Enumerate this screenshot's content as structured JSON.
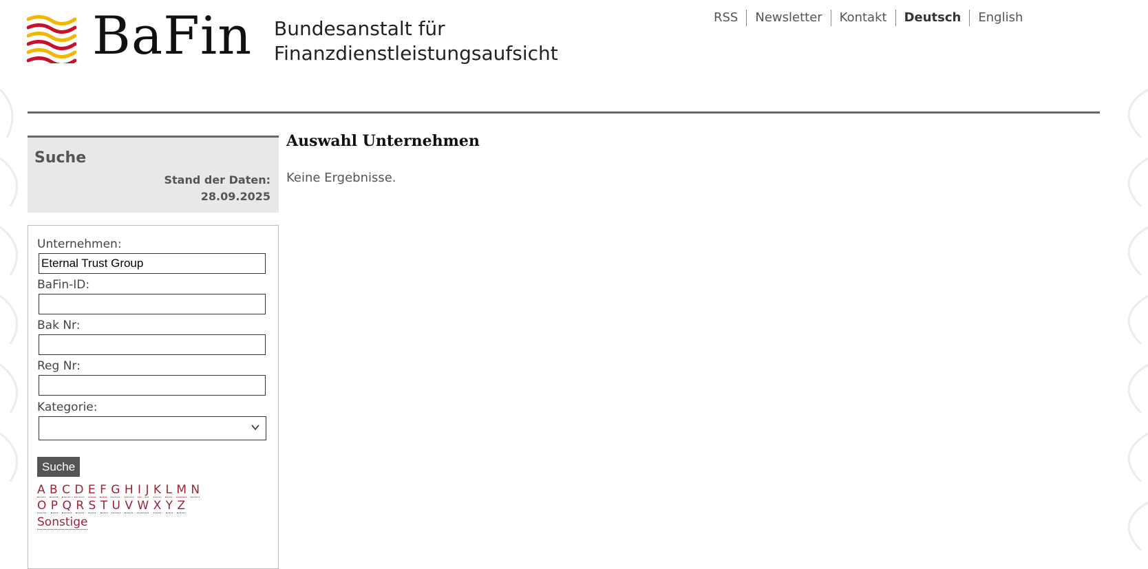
{
  "header": {
    "logo_word": "BaFin",
    "logo_sub_line1": "Bundesanstalt für",
    "logo_sub_line2": "Finanzdienstleistungsaufsicht",
    "nav": [
      {
        "label": "RSS"
      },
      {
        "label": "Newsletter"
      },
      {
        "label": "Kontakt"
      },
      {
        "label": "Deutsch",
        "active": true
      },
      {
        "label": "English"
      }
    ]
  },
  "sidebar": {
    "title": "Suche",
    "stand_label": "Stand der Daten:",
    "stand_date": "28.09.2025",
    "fields": {
      "unternehmen_label": "Unternehmen:",
      "unternehmen_value": "Eternal Trust Group",
      "bafin_id_label": "BaFin-ID:",
      "bafin_id_value": "",
      "bak_nr_label": "Bak Nr:",
      "bak_nr_value": "",
      "reg_nr_label": "Reg Nr:",
      "reg_nr_value": "",
      "kategorie_label": "Kategorie:",
      "kategorie_value": ""
    },
    "search_button": "Suche",
    "alpha_row1": [
      "A",
      "B",
      "C",
      "D",
      "E",
      "F",
      "G",
      "H",
      "I",
      "J",
      "K",
      "L",
      "M",
      "N"
    ],
    "alpha_row2": [
      "O",
      "P",
      "Q",
      "R",
      "S",
      "T",
      "U",
      "V",
      "W",
      "X",
      "Y",
      "Z"
    ],
    "other_link": "Sonstige"
  },
  "main": {
    "title": "Auswahl Unternehmen",
    "message": "Keine Ergebnisse."
  },
  "colors": {
    "link": "#9b2335",
    "rule": "#666666",
    "panel_bg": "#e8e8e8",
    "logo_red": "#c8102e",
    "logo_yellow": "#f2b705"
  }
}
